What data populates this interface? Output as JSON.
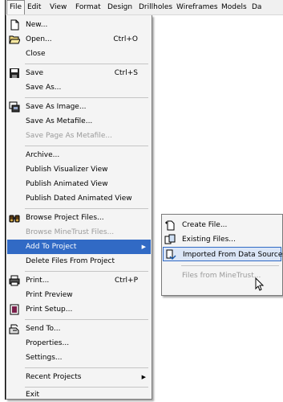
{
  "menubar": {
    "items": [
      "File",
      "Edit",
      "View",
      "Format",
      "Design",
      "Drillholes",
      "Wireframes",
      "Models",
      "Da"
    ]
  },
  "file_menu": {
    "new": "New...",
    "open": "Open...",
    "open_shortcut": "Ctrl+O",
    "close": "Close",
    "save": "Save",
    "save_shortcut": "Ctrl+S",
    "save_as": "Save As...",
    "save_as_image": "Save As Image...",
    "save_as_metafile": "Save As Metafile...",
    "save_page_as_metafile": "Save Page As Metafile...",
    "archive": "Archive...",
    "publish_visualizer": "Publish Visualizer View",
    "publish_animated": "Publish Animated View",
    "publish_dated_animated": "Publish Dated Animated View",
    "browse_project_files": "Browse Project Files...",
    "browse_minetrust_files": "Browse MineTrust Files...",
    "add_to_project": "Add To Project",
    "delete_files_from_project": "Delete Files From Project",
    "print": "Print...",
    "print_shortcut": "Ctrl+P",
    "print_preview": "Print Preview",
    "print_setup": "Print Setup...",
    "send_to": "Send To...",
    "properties": "Properties...",
    "settings": "Settings...",
    "recent_projects": "Recent Projects",
    "exit": "Exit"
  },
  "add_to_project_menu": {
    "create_file": "Create File...",
    "existing_files": "Existing Files...",
    "imported_from_data_source": "Imported From Data Source...",
    "files_from_minetrust": "Files from MineTrust..."
  },
  "colors": {
    "highlight": "#316ac5",
    "menu_background": "#f4f4f4",
    "disabled_text": "#9a9a9a"
  },
  "icons": [
    "new-file-icon",
    "open-folder-icon",
    "save-floppy-icon",
    "save-image-icon",
    "browse-binoculars-icon",
    "printer-icon",
    "print-setup-icon",
    "send-to-icon",
    "submenu-arrow-icon",
    "create-file-icon",
    "existing-files-icon",
    "import-data-icon",
    "mouse-cursor-icon"
  ]
}
